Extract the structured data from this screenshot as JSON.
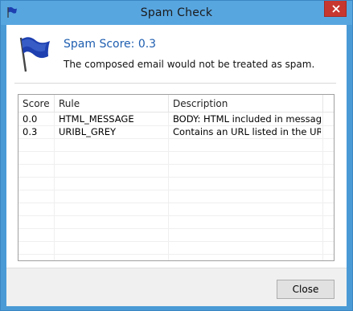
{
  "window": {
    "title": "Spam Check"
  },
  "header": {
    "score_title": "Spam Score: 0.3",
    "message": "The composed email would not be treated as spam."
  },
  "table": {
    "columns": [
      "Score",
      "Rule",
      "Description"
    ],
    "rows": [
      {
        "score": "0.0",
        "rule": "HTML_MESSAGE",
        "description": "BODY: HTML included in message"
      },
      {
        "score": "0.3",
        "rule": "URIBL_GREY",
        "description": "Contains an URL listed in the URIB..."
      }
    ]
  },
  "footer": {
    "close_label": "Close"
  },
  "colors": {
    "accent": "#1e5eb0",
    "titlebar": "#58a6e0",
    "close_red": "#c7372f",
    "flag_blue": "#1d3fb0"
  },
  "icons": {
    "title": "blue-flag-icon",
    "header": "blue-flag-icon",
    "close": "close-icon"
  }
}
